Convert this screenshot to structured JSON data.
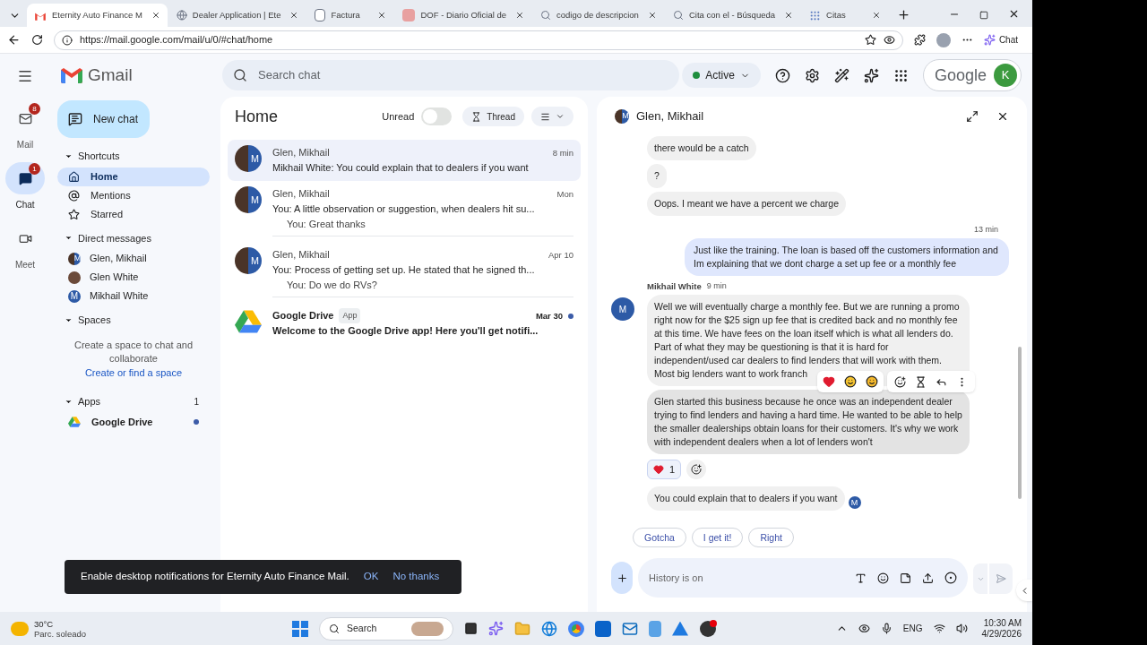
{
  "browser": {
    "tabs": [
      {
        "title": "Eternity Auto Finance M",
        "selected": true
      },
      {
        "title": "Dealer Application | Ete",
        "selected": false
      },
      {
        "title": "Factura",
        "selected": false
      },
      {
        "title": "DOF - Diario Oficial de",
        "selected": false
      },
      {
        "title": "codigo de descripcion",
        "selected": false
      },
      {
        "title": "Cita con el - Búsqueda",
        "selected": false
      },
      {
        "title": "Citas",
        "selected": false
      }
    ],
    "url": "https://mail.google.com/mail/u/0/#chat/home",
    "profile_label": "Chat"
  },
  "gmail": {
    "brand": "Gmail",
    "search_placeholder": "Search chat",
    "status": "Active",
    "account_brand": "Google",
    "account_letter": "K",
    "rail": [
      {
        "label": "Mail",
        "badge": "8",
        "selected": false
      },
      {
        "label": "Chat",
        "badge": "1",
        "selected": true
      },
      {
        "label": "Meet",
        "selected": false
      }
    ],
    "new_chat": "New chat",
    "shortcuts": {
      "title": "Shortcuts",
      "items": [
        {
          "label": "Home",
          "selected": true
        },
        {
          "label": "Mentions",
          "selected": false
        },
        {
          "label": "Starred",
          "selected": false
        }
      ]
    },
    "direct_messages": {
      "title": "Direct messages",
      "items": [
        {
          "name": "Glen, Mikhail",
          "kind": "group",
          "letter": "M"
        },
        {
          "name": "Glen White",
          "kind": "photo"
        },
        {
          "name": "Mikhail White",
          "kind": "letter",
          "letter": "M"
        }
      ]
    },
    "spaces": {
      "title": "Spaces",
      "text": "Create a space to chat and collaborate",
      "link": "Create or find a space"
    },
    "apps": {
      "title": "Apps",
      "count": "1",
      "items": [
        {
          "name": "Google Drive",
          "unread": true
        }
      ]
    }
  },
  "home": {
    "title": "Home",
    "unread_toggle": {
      "label": "Unread",
      "on": false
    },
    "thread": "Thread",
    "conversations": [
      {
        "kind": "group",
        "letter": "M",
        "name": "Glen, Mikhail",
        "time": "8 min",
        "preview": "Mikhail White: You could explain that to dealers if you want",
        "selected": true,
        "unread": false
      },
      {
        "kind": "group",
        "letter": "M",
        "name": "Glen, Mikhail",
        "time": "Mon",
        "preview": "You: A little observation or suggestion, when dealers hit su...",
        "reply": "You: Great thanks",
        "selected": false,
        "unread": false
      },
      {
        "kind": "group",
        "letter": "M",
        "name": "Glen, Mikhail",
        "time": "Apr 10",
        "preview": "You: Process of getting set up. He stated that he signed th...",
        "reply": "You: Do we do RVs?",
        "selected": false,
        "unread": false
      },
      {
        "kind": "app",
        "name": "Google Drive",
        "tag": "App",
        "time": "Mar 30",
        "preview": "Welcome to the Google Drive app! Here you'll get notifi...",
        "selected": false,
        "unread": true
      }
    ]
  },
  "chat": {
    "title": "Glen, Mikhail",
    "avatar_letter": "M",
    "messages": [
      {
        "kind": "incoming",
        "text": "there would be a catch",
        "hovered": false
      },
      {
        "kind": "incoming",
        "text": "?",
        "hovered": false
      },
      {
        "kind": "incoming",
        "text": "Oops. I meant we have a percent we charge",
        "hovered": false
      },
      {
        "kind": "outgoing",
        "time": "13 min",
        "text": "Just like the training. The loan is based off the customers information and Im explaining that we dont charge a set up fee or a monthly fee",
        "hovered": false
      },
      {
        "kind": "incoming",
        "sender": "Mikhail White",
        "time": "9 min",
        "avatar": "M",
        "text": "Well we will eventually charge a monthly fee. But we are running a promo right now for the $25 sign up fee that is credited back and no monthly fee at this time. We have fees on the loan itself which is what all lenders do. Part of what they may be questioning is that it is hard for independent/used car dealers to find lenders that will work with them. Most big lenders want to work franch",
        "hovered": false
      },
      {
        "kind": "incoming",
        "text": "Glen started this business because he once was an independent dealer trying to find lenders and having a hard time. He wanted to be able to help the smaller dealerships obtain loans for their customers. It's why we work with independent dealers when a lot of lenders won't",
        "hovered": true,
        "reactions": [
          {
            "count": "1",
            "selected": true
          }
        ]
      },
      {
        "kind": "incoming",
        "text": "You could explain that to dealers if  you want",
        "hovered": false,
        "seen_by": "M"
      }
    ],
    "suggestions": [
      "Gotcha",
      "I get it!",
      "Right"
    ],
    "composer_placeholder": "History is on"
  },
  "toast": {
    "text": "Enable desktop notifications for Eternity Auto Finance Mail.",
    "ok": "OK",
    "dismiss": "No thanks"
  },
  "taskbar": {
    "temperature": "30°C",
    "weather": "Parc. soleado",
    "search": "Search",
    "language": "ENG",
    "time": "10:30 AM",
    "date": "4/29/2026"
  }
}
